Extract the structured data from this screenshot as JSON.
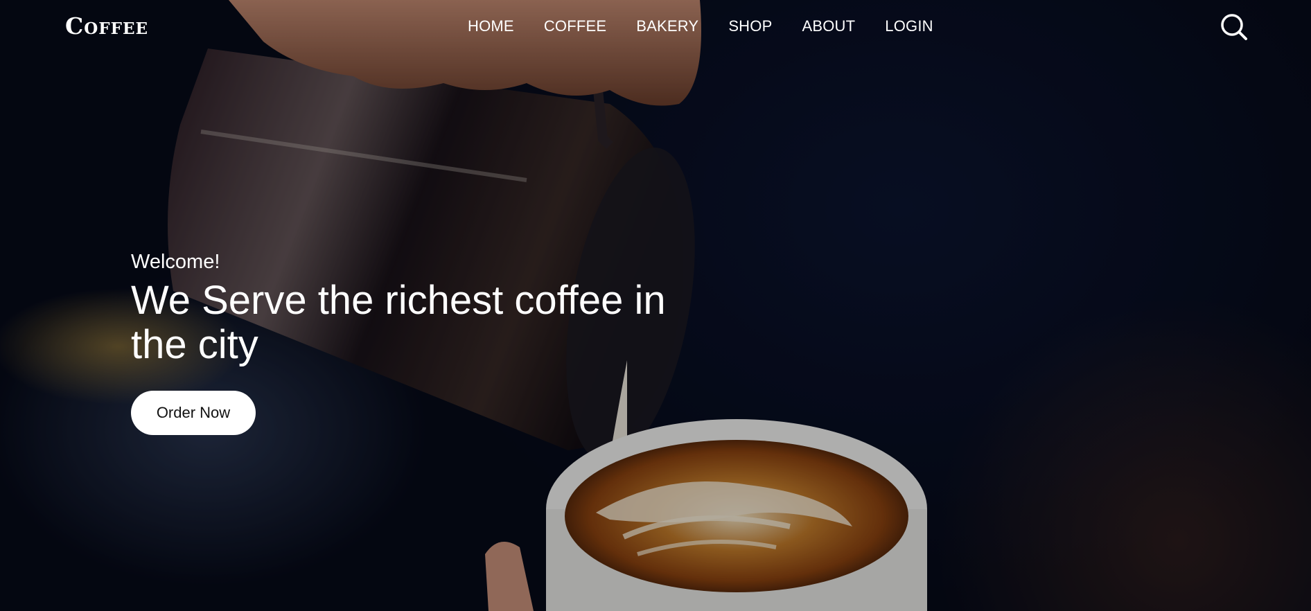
{
  "header": {
    "logo": "Coffee",
    "nav": [
      "HOME",
      "COFFEE",
      "BAKERY",
      "SHOP",
      "ABOUT",
      "LOGIN"
    ]
  },
  "hero": {
    "welcome": "Welcome!",
    "headline": "We Serve the richest coffee in the city",
    "cta_label": "Order Now"
  },
  "icons": {
    "search": "search-icon"
  },
  "colors": {
    "background": "#060a16",
    "text": "#ffffff",
    "button_bg": "#ffffff",
    "button_text": "#111111"
  }
}
